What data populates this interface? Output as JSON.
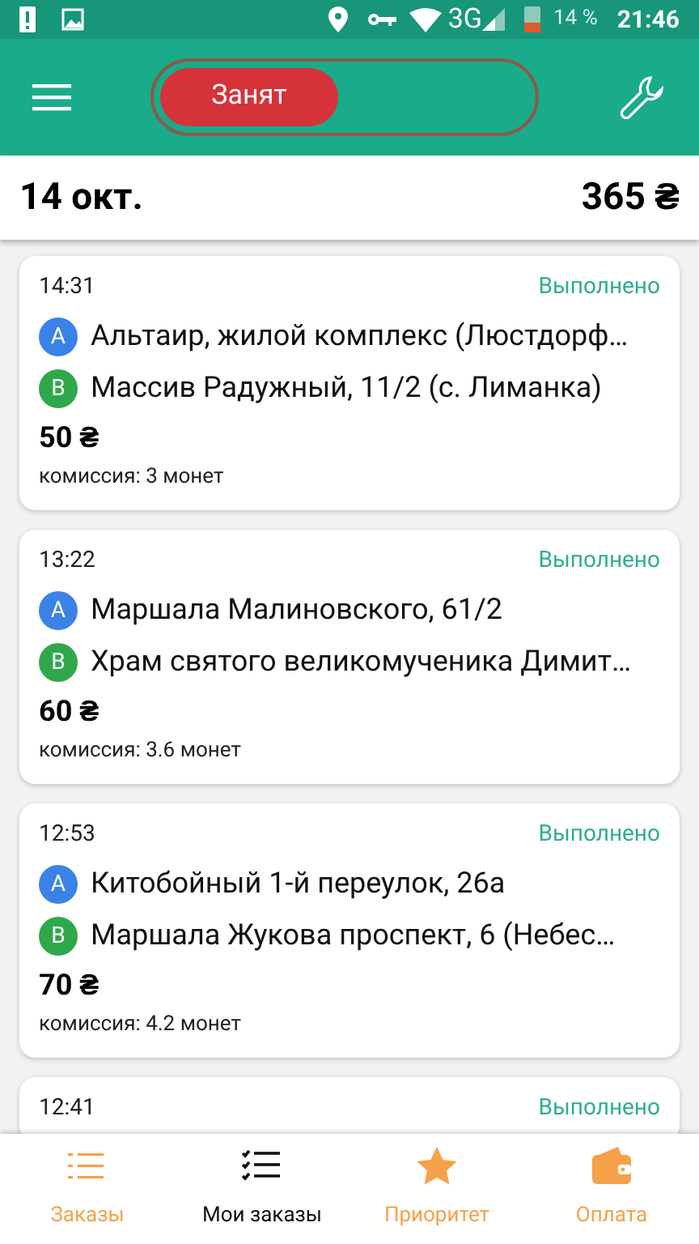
{
  "status_bar": {
    "network": "3G",
    "battery": "14 %",
    "time": "21:46"
  },
  "toolbar": {
    "toggle": {
      "label": "Занят",
      "on": false
    }
  },
  "summary": {
    "date": "14 окт.",
    "total": "365 ₴"
  },
  "orders": [
    {
      "time": "14:31",
      "status": "Выполнено",
      "points": [
        {
          "letter": "A",
          "color": "#3b82e6",
          "address": "Альтаир, жилой комплекс (Люстдорф…"
        },
        {
          "letter": "B",
          "color": "#2ea84a",
          "address": "Массив Радужный, 11/2 (с. Лиманка)"
        }
      ],
      "price": "50 ₴",
      "commission": "комиссия: 3 монет"
    },
    {
      "time": "13:22",
      "status": "Выполнено",
      "points": [
        {
          "letter": "A",
          "color": "#3b82e6",
          "address": "Маршала Малиновского, 61/2"
        },
        {
          "letter": "B",
          "color": "#2ea84a",
          "address": "Храм святого великомученика Димит…"
        }
      ],
      "price": "60 ₴",
      "commission": "комиссия: 3.6 монет"
    },
    {
      "time": "12:53",
      "status": "Выполнено",
      "points": [
        {
          "letter": "A",
          "color": "#3b82e6",
          "address": "Китобойный 1-й переулок, 26а"
        },
        {
          "letter": "B",
          "color": "#2ea84a",
          "address": "Маршала Жукова проспект, 6  (Небес…"
        }
      ],
      "price": "70 ₴",
      "commission": "комиссия: 4.2 монет"
    },
    {
      "time": "12:41",
      "status": "Выполнено"
    }
  ],
  "bottom_nav": [
    {
      "label": "Заказы",
      "kind": "list",
      "selected": false
    },
    {
      "label": "Мои заказы",
      "kind": "checklist",
      "selected": true
    },
    {
      "label": "Приоритет",
      "kind": "star",
      "selected": false
    },
    {
      "label": "Оплата",
      "kind": "wallet",
      "selected": false
    }
  ]
}
